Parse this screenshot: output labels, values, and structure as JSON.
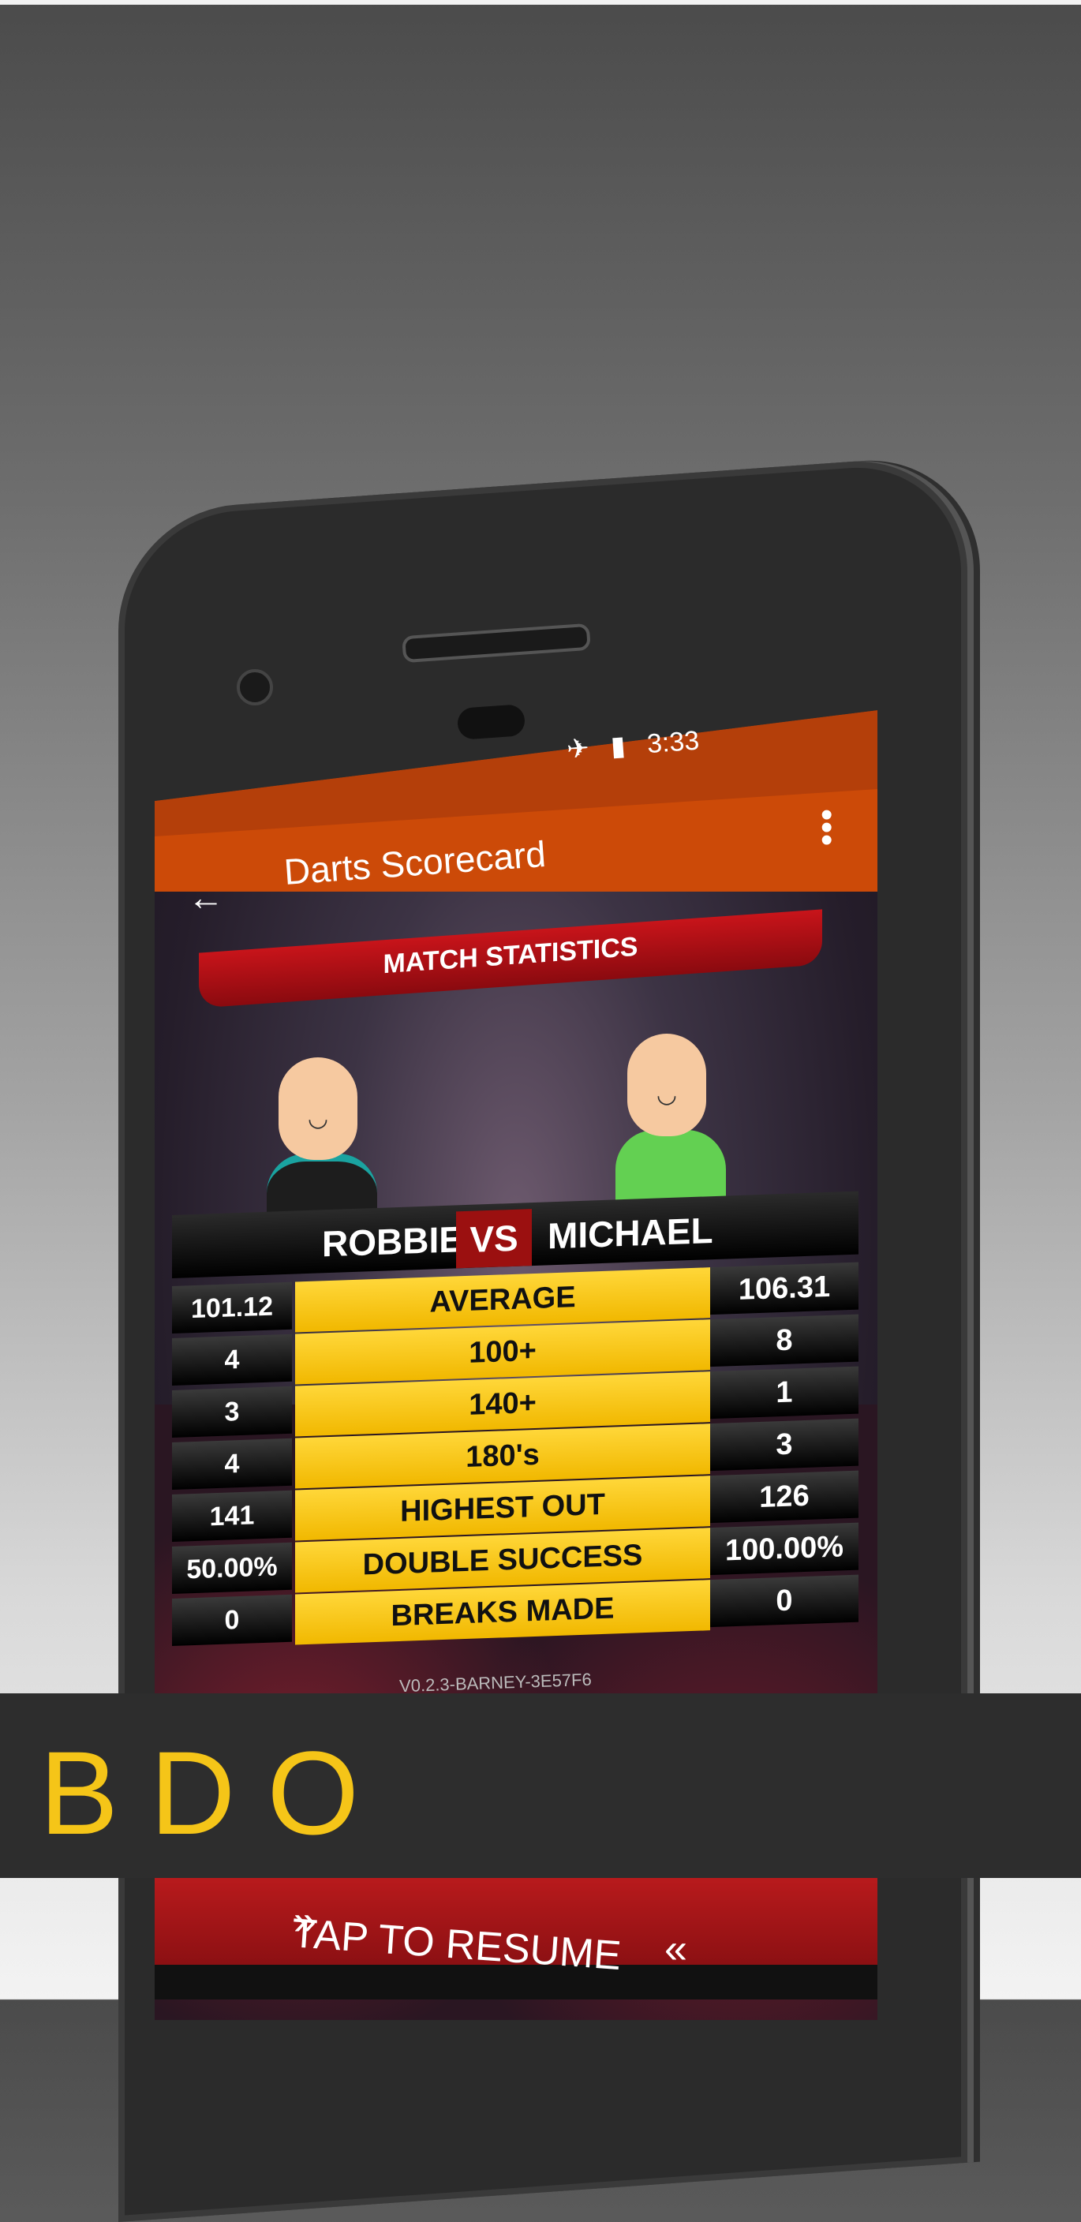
{
  "status_bar": {
    "time": "3:33",
    "icons": [
      "airplane-icon",
      "battery-icon"
    ]
  },
  "app_bar": {
    "title": "Darts Scorecard",
    "back_icon": "back-arrow-icon",
    "menu_icon": "overflow-menu-icon"
  },
  "banner": {
    "label": "MATCH STATISTICS"
  },
  "match": {
    "player1": "ROBBIE",
    "vs": "VS",
    "player2": "MICHAEL",
    "stats": [
      {
        "label": "AVERAGE",
        "p1": "101.12",
        "p2": "106.31"
      },
      {
        "label": "100+",
        "p1": "4",
        "p2": "8"
      },
      {
        "label": "140+",
        "p1": "3",
        "p2": "1"
      },
      {
        "label": "180's",
        "p1": "4",
        "p2": "3"
      },
      {
        "label": "HIGHEST OUT",
        "p1": "141",
        "p2": "126"
      },
      {
        "label": "DOUBLE SUCCESS",
        "p1": "50.00%",
        "p2": "100.00%"
      },
      {
        "label": "BREAKS MADE",
        "p1": "0",
        "p2": "0"
      }
    ]
  },
  "version": "V0.2.3-BARNEY-3E57F6",
  "overlay": {
    "label": "BDO"
  },
  "resume": {
    "label": "TAP TO RESUME"
  },
  "colors": {
    "accent": "#cc4a08",
    "status": "#b43f0a",
    "gold": "#f5c518",
    "red": "#9b1010",
    "yellow": "#ffd739"
  }
}
